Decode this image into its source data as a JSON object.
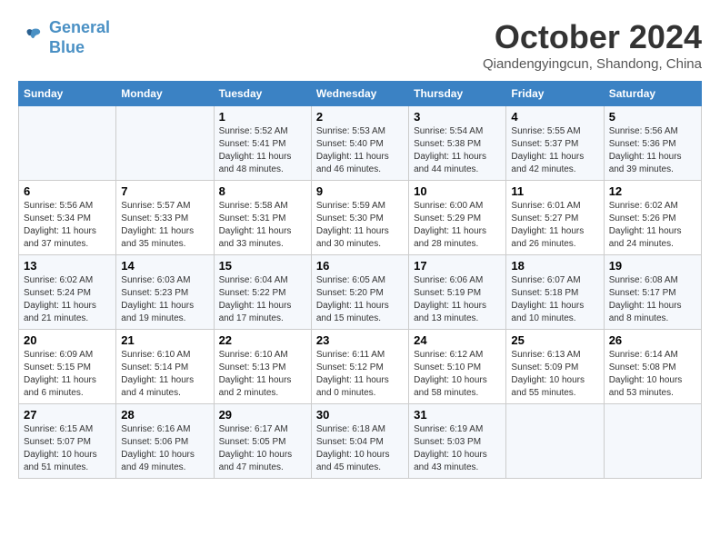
{
  "header": {
    "logo_line1": "General",
    "logo_line2": "Blue",
    "month": "October 2024",
    "location": "Qiandengyingcun, Shandong, China"
  },
  "weekdays": [
    "Sunday",
    "Monday",
    "Tuesday",
    "Wednesday",
    "Thursday",
    "Friday",
    "Saturday"
  ],
  "weeks": [
    [
      {
        "day": "",
        "info": ""
      },
      {
        "day": "",
        "info": ""
      },
      {
        "day": "1",
        "info": "Sunrise: 5:52 AM\nSunset: 5:41 PM\nDaylight: 11 hours and 48 minutes."
      },
      {
        "day": "2",
        "info": "Sunrise: 5:53 AM\nSunset: 5:40 PM\nDaylight: 11 hours and 46 minutes."
      },
      {
        "day": "3",
        "info": "Sunrise: 5:54 AM\nSunset: 5:38 PM\nDaylight: 11 hours and 44 minutes."
      },
      {
        "day": "4",
        "info": "Sunrise: 5:55 AM\nSunset: 5:37 PM\nDaylight: 11 hours and 42 minutes."
      },
      {
        "day": "5",
        "info": "Sunrise: 5:56 AM\nSunset: 5:36 PM\nDaylight: 11 hours and 39 minutes."
      }
    ],
    [
      {
        "day": "6",
        "info": "Sunrise: 5:56 AM\nSunset: 5:34 PM\nDaylight: 11 hours and 37 minutes."
      },
      {
        "day": "7",
        "info": "Sunrise: 5:57 AM\nSunset: 5:33 PM\nDaylight: 11 hours and 35 minutes."
      },
      {
        "day": "8",
        "info": "Sunrise: 5:58 AM\nSunset: 5:31 PM\nDaylight: 11 hours and 33 minutes."
      },
      {
        "day": "9",
        "info": "Sunrise: 5:59 AM\nSunset: 5:30 PM\nDaylight: 11 hours and 30 minutes."
      },
      {
        "day": "10",
        "info": "Sunrise: 6:00 AM\nSunset: 5:29 PM\nDaylight: 11 hours and 28 minutes."
      },
      {
        "day": "11",
        "info": "Sunrise: 6:01 AM\nSunset: 5:27 PM\nDaylight: 11 hours and 26 minutes."
      },
      {
        "day": "12",
        "info": "Sunrise: 6:02 AM\nSunset: 5:26 PM\nDaylight: 11 hours and 24 minutes."
      }
    ],
    [
      {
        "day": "13",
        "info": "Sunrise: 6:02 AM\nSunset: 5:24 PM\nDaylight: 11 hours and 21 minutes."
      },
      {
        "day": "14",
        "info": "Sunrise: 6:03 AM\nSunset: 5:23 PM\nDaylight: 11 hours and 19 minutes."
      },
      {
        "day": "15",
        "info": "Sunrise: 6:04 AM\nSunset: 5:22 PM\nDaylight: 11 hours and 17 minutes."
      },
      {
        "day": "16",
        "info": "Sunrise: 6:05 AM\nSunset: 5:20 PM\nDaylight: 11 hours and 15 minutes."
      },
      {
        "day": "17",
        "info": "Sunrise: 6:06 AM\nSunset: 5:19 PM\nDaylight: 11 hours and 13 minutes."
      },
      {
        "day": "18",
        "info": "Sunrise: 6:07 AM\nSunset: 5:18 PM\nDaylight: 11 hours and 10 minutes."
      },
      {
        "day": "19",
        "info": "Sunrise: 6:08 AM\nSunset: 5:17 PM\nDaylight: 11 hours and 8 minutes."
      }
    ],
    [
      {
        "day": "20",
        "info": "Sunrise: 6:09 AM\nSunset: 5:15 PM\nDaylight: 11 hours and 6 minutes."
      },
      {
        "day": "21",
        "info": "Sunrise: 6:10 AM\nSunset: 5:14 PM\nDaylight: 11 hours and 4 minutes."
      },
      {
        "day": "22",
        "info": "Sunrise: 6:10 AM\nSunset: 5:13 PM\nDaylight: 11 hours and 2 minutes."
      },
      {
        "day": "23",
        "info": "Sunrise: 6:11 AM\nSunset: 5:12 PM\nDaylight: 11 hours and 0 minutes."
      },
      {
        "day": "24",
        "info": "Sunrise: 6:12 AM\nSunset: 5:10 PM\nDaylight: 10 hours and 58 minutes."
      },
      {
        "day": "25",
        "info": "Sunrise: 6:13 AM\nSunset: 5:09 PM\nDaylight: 10 hours and 55 minutes."
      },
      {
        "day": "26",
        "info": "Sunrise: 6:14 AM\nSunset: 5:08 PM\nDaylight: 10 hours and 53 minutes."
      }
    ],
    [
      {
        "day": "27",
        "info": "Sunrise: 6:15 AM\nSunset: 5:07 PM\nDaylight: 10 hours and 51 minutes."
      },
      {
        "day": "28",
        "info": "Sunrise: 6:16 AM\nSunset: 5:06 PM\nDaylight: 10 hours and 49 minutes."
      },
      {
        "day": "29",
        "info": "Sunrise: 6:17 AM\nSunset: 5:05 PM\nDaylight: 10 hours and 47 minutes."
      },
      {
        "day": "30",
        "info": "Sunrise: 6:18 AM\nSunset: 5:04 PM\nDaylight: 10 hours and 45 minutes."
      },
      {
        "day": "31",
        "info": "Sunrise: 6:19 AM\nSunset: 5:03 PM\nDaylight: 10 hours and 43 minutes."
      },
      {
        "day": "",
        "info": ""
      },
      {
        "day": "",
        "info": ""
      }
    ]
  ]
}
